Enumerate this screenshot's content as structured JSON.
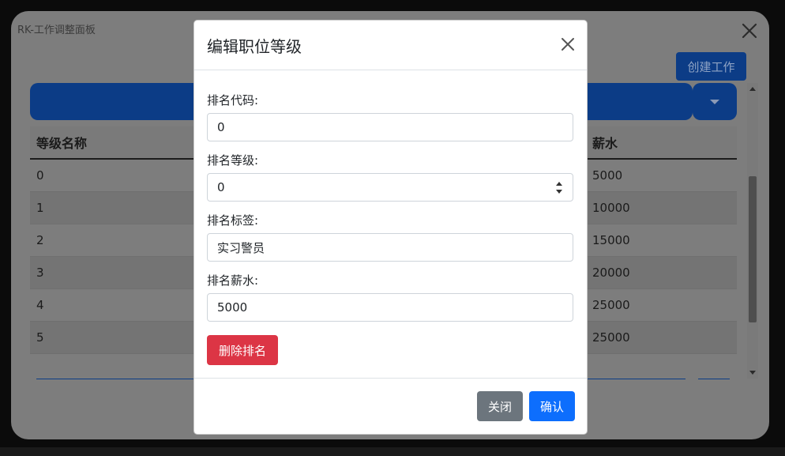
{
  "app": {
    "title": "RK-工作调整面板"
  },
  "toolbar": {
    "create_label": "创建工作"
  },
  "table": {
    "headers": [
      "等级名称",
      "薪水"
    ],
    "rows": [
      [
        "0",
        "5000"
      ],
      [
        "1",
        "10000"
      ],
      [
        "2",
        "15000"
      ],
      [
        "3",
        "20000"
      ],
      [
        "4",
        "25000"
      ],
      [
        "5",
        "25000"
      ]
    ]
  },
  "modal": {
    "title": "编辑职位等级",
    "fields": {
      "code_label": "排名代码:",
      "code_value": "0",
      "level_label": "排名等级:",
      "level_value": "0",
      "tag_label": "排名标签:",
      "tag_value": "实习警员",
      "salary_label": "排名薪水:",
      "salary_value": "5000"
    },
    "delete_label": "删除排名",
    "close_label": "关闭",
    "confirm_label": "确认"
  },
  "colors": {
    "primary": "#0d6efd",
    "danger": "#dc3545",
    "secondary": "#6c757d",
    "dimmed_primary": "#0c3c86"
  },
  "icons": [
    "close-icon",
    "caret-down-icon",
    "spinner-icon"
  ]
}
